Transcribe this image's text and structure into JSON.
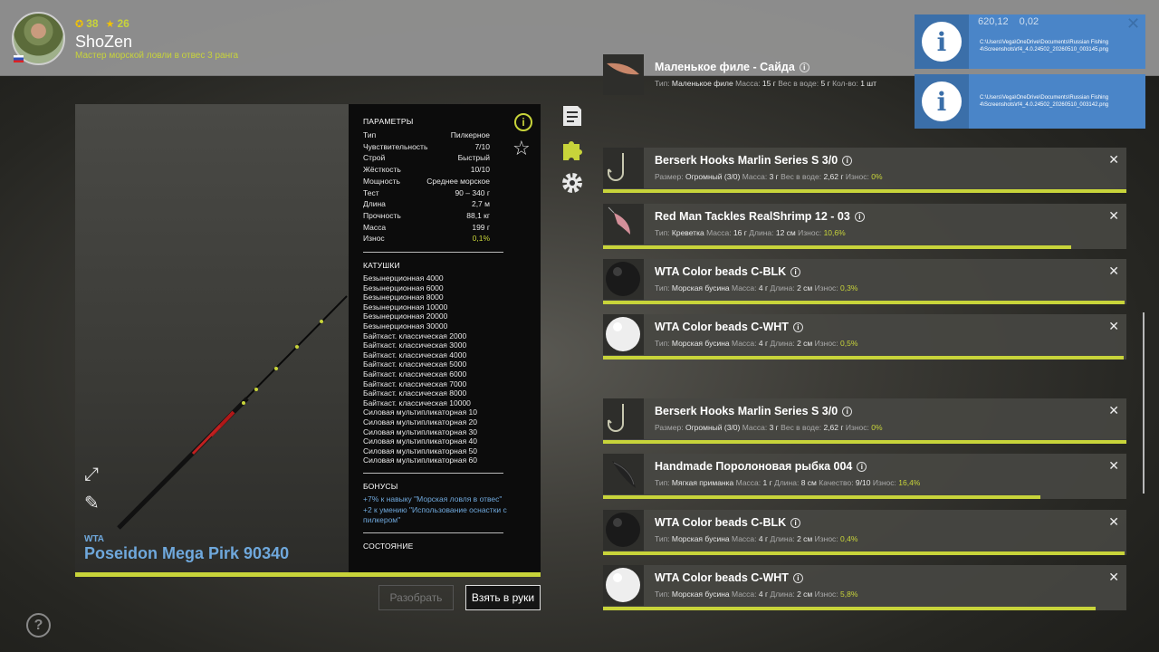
{
  "player": {
    "coins": "38",
    "stars": "26",
    "name": "ShoZen",
    "rank": "Мастер морской ловли в отвес 3 ранга"
  },
  "notifications": {
    "money": "620,12",
    "gold": "0,02",
    "items": [
      {
        "path": "C:\\Users\\Vega\\OneDrive\\Documents\\Russian Fishing 4\\Screenshots\\rf4_4.0.24502_20260510_003145.png"
      },
      {
        "path": "C:\\Users\\Vega\\OneDrive\\Documents\\Russian Fishing 4\\Screenshots\\rf4_4.0.24502_20260510_003142.png"
      }
    ]
  },
  "item": {
    "brand": "WTA",
    "name": "Poseidon Mega Pirk 90340",
    "params_title": "ПАРАМЕТРЫ",
    "params": [
      {
        "label": "Тип",
        "value": "Пилкерное"
      },
      {
        "label": "Чувствительность",
        "value": "7/10"
      },
      {
        "label": "Строй",
        "value": "Быстрый"
      },
      {
        "label": "Жёсткость",
        "value": "10/10"
      },
      {
        "label": "Мощность",
        "value": "Среднее морское"
      },
      {
        "label": "Тест",
        "value": "90 – 340 г"
      },
      {
        "label": "Длина",
        "value": "2,7 м"
      },
      {
        "label": "Прочность",
        "value": "88,1 кг"
      },
      {
        "label": "Масса",
        "value": "199 г"
      },
      {
        "label": "Износ",
        "value": "0,1%"
      }
    ],
    "reels_title": "КАТУШКИ",
    "reels": [
      "Безынерционная 4000",
      "Безынерционная 6000",
      "Безынерционная 8000",
      "Безынерционная 10000",
      "Безынерционная 20000",
      "Безынерционная 30000",
      "Байткаст. классическая 2000",
      "Байткаст. классическая 3000",
      "Байткаст. классическая 4000",
      "Байткаст. классическая 5000",
      "Байткаст. классическая 6000",
      "Байткаст. классическая 7000",
      "Байткаст. классическая 8000",
      "Байткаст. классическая 10000",
      "Силовая мультипликаторная 10",
      "Силовая мультипликаторная 20",
      "Силовая мультипликаторная 30",
      "Силовая мультипликаторная 40",
      "Силовая мультипликаторная 50",
      "Силовая мультипликаторная 60"
    ],
    "bonuses_title": "БОНУСЫ",
    "bonuses": [
      "+7% к навыку \"Морская ловля в отвес\"",
      "+2 к умению \"Использование оснастки с пилкером\""
    ],
    "condition_title": "СОСТОЯНИЕ"
  },
  "buttons": {
    "disassemble": "Разобрать",
    "take": "Взять в руки"
  },
  "tackle": [
    {
      "title": "Маленькое филе - Сайда",
      "desc": [
        [
          "Тип:",
          "Маленькое филе"
        ],
        [
          "Масса:",
          "15 г"
        ],
        [
          "Вес в воде:",
          "5 г"
        ],
        [
          "Кол-во:",
          "1 шт"
        ]
      ],
      "wear": "",
      "wear_fraction": 0,
      "icon": "fish-fillet-icon"
    },
    {
      "title": "Berserk Hooks Marlin Series S 3/0",
      "desc": [
        [
          "Размер:",
          "Огромный (3/0)"
        ],
        [
          "Масса:",
          "3 г"
        ],
        [
          "Вес в воде:",
          "2,62 г"
        ],
        [
          "Износ:",
          ""
        ]
      ],
      "wear": "0%",
      "wear_fraction": 1.0,
      "icon": "hook-icon"
    },
    {
      "title": "Red Man Tackles RealShrimp 12 - 03",
      "desc": [
        [
          "Тип:",
          "Креветка"
        ],
        [
          "Масса:",
          "16 г"
        ],
        [
          "Длина:",
          "12 см"
        ],
        [
          "Износ:",
          ""
        ]
      ],
      "wear": "10,6%",
      "wear_fraction": 0.894,
      "icon": "shrimp-icon"
    },
    {
      "title": "WTA Color beads C-BLK",
      "desc": [
        [
          "Тип:",
          "Морская бусина"
        ],
        [
          "Масса:",
          "4 г"
        ],
        [
          "Длина:",
          "2 см"
        ],
        [
          "Износ:",
          ""
        ]
      ],
      "wear": "0,3%",
      "wear_fraction": 0.997,
      "icon": "black-bead-icon"
    },
    {
      "title": "WTA Color beads C-WHT",
      "desc": [
        [
          "Тип:",
          "Морская бусина"
        ],
        [
          "Масса:",
          "4 г"
        ],
        [
          "Длина:",
          "2 см"
        ],
        [
          "Износ:",
          ""
        ]
      ],
      "wear": "0,5%",
      "wear_fraction": 0.995,
      "icon": "white-bead-icon"
    },
    {
      "title": "Berserk Hooks Marlin Series S 3/0",
      "desc": [
        [
          "Размер:",
          "Огромный (3/0)"
        ],
        [
          "Масса:",
          "3 г"
        ],
        [
          "Вес в воде:",
          "2,62 г"
        ],
        [
          "Износ:",
          ""
        ]
      ],
      "wear": "0%",
      "wear_fraction": 1.0,
      "icon": "hook-icon"
    },
    {
      "title": "Handmade Поролоновая рыбка 004",
      "desc": [
        [
          "Тип:",
          "Мягкая приманка"
        ],
        [
          "Масса:",
          "1 г"
        ],
        [
          "Длина:",
          "8 см"
        ],
        [
          "Качество:",
          "9/10"
        ],
        [
          "Износ:",
          ""
        ]
      ],
      "wear": "16,4%",
      "wear_fraction": 0.836,
      "icon": "foam-fish-icon"
    },
    {
      "title": "WTA Color beads C-BLK",
      "desc": [
        [
          "Тип:",
          "Морская бусина"
        ],
        [
          "Масса:",
          "4 г"
        ],
        [
          "Длина:",
          "2 см"
        ],
        [
          "Износ:",
          ""
        ]
      ],
      "wear": "0,4%",
      "wear_fraction": 0.996,
      "icon": "black-bead-icon"
    },
    {
      "title": "WTA Color beads C-WHT",
      "desc": [
        [
          "Тип:",
          "Морская бусина"
        ],
        [
          "Масса:",
          "4 г"
        ],
        [
          "Длина:",
          "2 см"
        ],
        [
          "Износ:",
          ""
        ]
      ],
      "wear": "5,8%",
      "wear_fraction": 0.942,
      "icon": "white-bead-icon"
    }
  ],
  "colors": {
    "accent": "#c8d43a",
    "link": "#6fa8dc",
    "notification": "#4a85c8"
  }
}
